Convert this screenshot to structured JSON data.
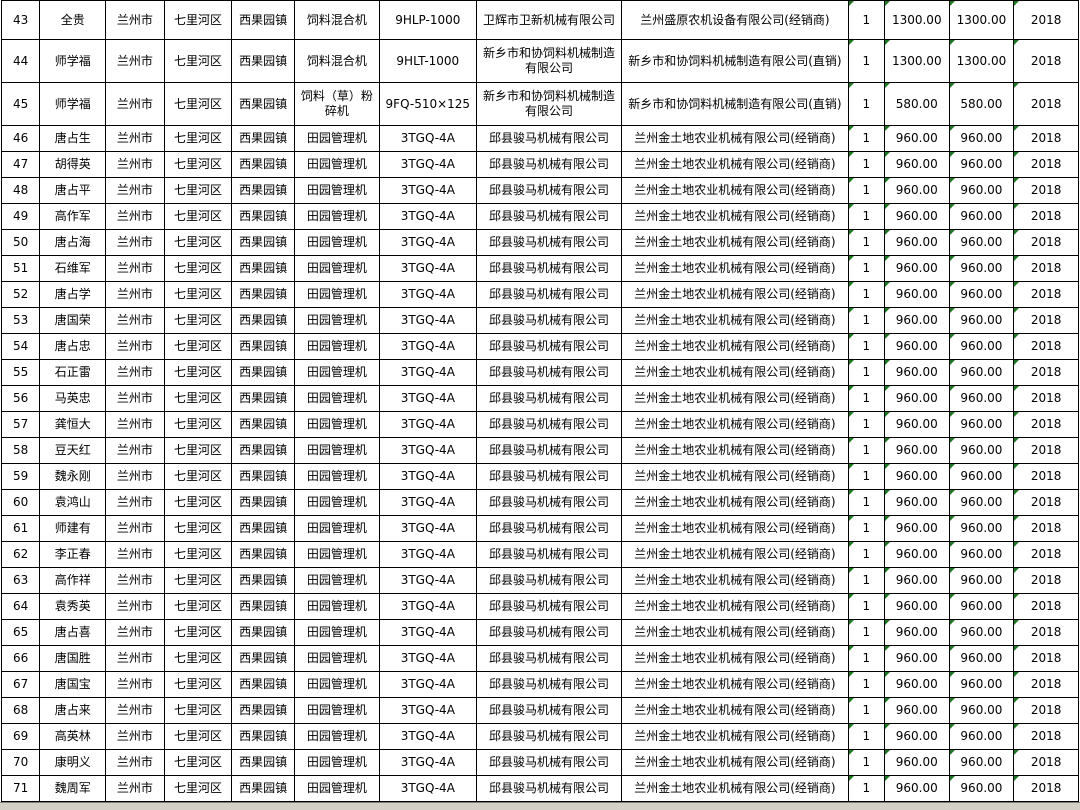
{
  "sheet": {
    "rows": [
      {
        "idx": "43",
        "name": "全贵",
        "city": "兰州市",
        "district": "七里河区",
        "town": "西果园镇",
        "machine": "饲料混合机",
        "model": "9HLP-1000",
        "maker": "卫辉市卫新机械有限公司",
        "dealer": "兰州盛原农机设备有限公司(经销商)",
        "qty": "1",
        "price": "1300.00",
        "total": "1300.00",
        "year": "2018",
        "height": "first"
      },
      {
        "idx": "44",
        "name": "师学福",
        "city": "兰州市",
        "district": "七里河区",
        "town": "西果园镇",
        "machine": "饲料混合机",
        "model": "9HLT-1000",
        "maker": "新乡市和协饲料机械制造有限公司",
        "dealer": "新乡市和协饲料机械制造有限公司(直销)",
        "qty": "1",
        "price": "1300.00",
        "total": "1300.00",
        "year": "2018",
        "height": "tall"
      },
      {
        "idx": "45",
        "name": "师学福",
        "city": "兰州市",
        "district": "七里河区",
        "town": "西果园镇",
        "machine": "饲料（草）粉碎机",
        "model": "9FQ-510×125",
        "maker": "新乡市和协饲料机械制造有限公司",
        "dealer": "新乡市和协饲料机械制造有限公司(直销)",
        "qty": "1",
        "price": "580.00",
        "total": "580.00",
        "year": "2018",
        "height": "tall"
      },
      {
        "idx": "46",
        "name": "唐占生",
        "city": "兰州市",
        "district": "七里河区",
        "town": "西果园镇",
        "machine": "田园管理机",
        "model": "3TGQ-4A",
        "maker": "邱县骏马机械有限公司",
        "dealer": "兰州金土地农业机械有限公司(经销商)",
        "qty": "1",
        "price": "960.00",
        "total": "960.00",
        "year": "2018",
        "height": "norm"
      },
      {
        "idx": "47",
        "name": "胡得英",
        "city": "兰州市",
        "district": "七里河区",
        "town": "西果园镇",
        "machine": "田园管理机",
        "model": "3TGQ-4A",
        "maker": "邱县骏马机械有限公司",
        "dealer": "兰州金土地农业机械有限公司(经销商)",
        "qty": "1",
        "price": "960.00",
        "total": "960.00",
        "year": "2018",
        "height": "norm"
      },
      {
        "idx": "48",
        "name": "唐占平",
        "city": "兰州市",
        "district": "七里河区",
        "town": "西果园镇",
        "machine": "田园管理机",
        "model": "3TGQ-4A",
        "maker": "邱县骏马机械有限公司",
        "dealer": "兰州金土地农业机械有限公司(经销商)",
        "qty": "1",
        "price": "960.00",
        "total": "960.00",
        "year": "2018",
        "height": "norm"
      },
      {
        "idx": "49",
        "name": "高作军",
        "city": "兰州市",
        "district": "七里河区",
        "town": "西果园镇",
        "machine": "田园管理机",
        "model": "3TGQ-4A",
        "maker": "邱县骏马机械有限公司",
        "dealer": "兰州金土地农业机械有限公司(经销商)",
        "qty": "1",
        "price": "960.00",
        "total": "960.00",
        "year": "2018",
        "height": "norm"
      },
      {
        "idx": "50",
        "name": "唐占海",
        "city": "兰州市",
        "district": "七里河区",
        "town": "西果园镇",
        "machine": "田园管理机",
        "model": "3TGQ-4A",
        "maker": "邱县骏马机械有限公司",
        "dealer": "兰州金土地农业机械有限公司(经销商)",
        "qty": "1",
        "price": "960.00",
        "total": "960.00",
        "year": "2018",
        "height": "norm"
      },
      {
        "idx": "51",
        "name": "石维军",
        "city": "兰州市",
        "district": "七里河区",
        "town": "西果园镇",
        "machine": "田园管理机",
        "model": "3TGQ-4A",
        "maker": "邱县骏马机械有限公司",
        "dealer": "兰州金土地农业机械有限公司(经销商)",
        "qty": "1",
        "price": "960.00",
        "total": "960.00",
        "year": "2018",
        "height": "norm"
      },
      {
        "idx": "52",
        "name": "唐占学",
        "city": "兰州市",
        "district": "七里河区",
        "town": "西果园镇",
        "machine": "田园管理机",
        "model": "3TGQ-4A",
        "maker": "邱县骏马机械有限公司",
        "dealer": "兰州金土地农业机械有限公司(经销商)",
        "qty": "1",
        "price": "960.00",
        "total": "960.00",
        "year": "2018",
        "height": "norm"
      },
      {
        "idx": "53",
        "name": "唐国荣",
        "city": "兰州市",
        "district": "七里河区",
        "town": "西果园镇",
        "machine": "田园管理机",
        "model": "3TGQ-4A",
        "maker": "邱县骏马机械有限公司",
        "dealer": "兰州金土地农业机械有限公司(经销商)",
        "qty": "1",
        "price": "960.00",
        "total": "960.00",
        "year": "2018",
        "height": "norm"
      },
      {
        "idx": "54",
        "name": "唐占忠",
        "city": "兰州市",
        "district": "七里河区",
        "town": "西果园镇",
        "machine": "田园管理机",
        "model": "3TGQ-4A",
        "maker": "邱县骏马机械有限公司",
        "dealer": "兰州金土地农业机械有限公司(经销商)",
        "qty": "1",
        "price": "960.00",
        "total": "960.00",
        "year": "2018",
        "height": "norm"
      },
      {
        "idx": "55",
        "name": "石正雷",
        "city": "兰州市",
        "district": "七里河区",
        "town": "西果园镇",
        "machine": "田园管理机",
        "model": "3TGQ-4A",
        "maker": "邱县骏马机械有限公司",
        "dealer": "兰州金土地农业机械有限公司(经销商)",
        "qty": "1",
        "price": "960.00",
        "total": "960.00",
        "year": "2018",
        "height": "norm"
      },
      {
        "idx": "56",
        "name": "马英忠",
        "city": "兰州市",
        "district": "七里河区",
        "town": "西果园镇",
        "machine": "田园管理机",
        "model": "3TGQ-4A",
        "maker": "邱县骏马机械有限公司",
        "dealer": "兰州金土地农业机械有限公司(经销商)",
        "qty": "1",
        "price": "960.00",
        "total": "960.00",
        "year": "2018",
        "height": "norm"
      },
      {
        "idx": "57",
        "name": "龚恒大",
        "city": "兰州市",
        "district": "七里河区",
        "town": "西果园镇",
        "machine": "田园管理机",
        "model": "3TGQ-4A",
        "maker": "邱县骏马机械有限公司",
        "dealer": "兰州金土地农业机械有限公司(经销商)",
        "qty": "1",
        "price": "960.00",
        "total": "960.00",
        "year": "2018",
        "height": "norm"
      },
      {
        "idx": "58",
        "name": "豆天红",
        "city": "兰州市",
        "district": "七里河区",
        "town": "西果园镇",
        "machine": "田园管理机",
        "model": "3TGQ-4A",
        "maker": "邱县骏马机械有限公司",
        "dealer": "兰州金土地农业机械有限公司(经销商)",
        "qty": "1",
        "price": "960.00",
        "total": "960.00",
        "year": "2018",
        "height": "norm"
      },
      {
        "idx": "59",
        "name": "魏永刚",
        "city": "兰州市",
        "district": "七里河区",
        "town": "西果园镇",
        "machine": "田园管理机",
        "model": "3TGQ-4A",
        "maker": "邱县骏马机械有限公司",
        "dealer": "兰州金土地农业机械有限公司(经销商)",
        "qty": "1",
        "price": "960.00",
        "total": "960.00",
        "year": "2018",
        "height": "norm"
      },
      {
        "idx": "60",
        "name": "袁鸿山",
        "city": "兰州市",
        "district": "七里河区",
        "town": "西果园镇",
        "machine": "田园管理机",
        "model": "3TGQ-4A",
        "maker": "邱县骏马机械有限公司",
        "dealer": "兰州金土地农业机械有限公司(经销商)",
        "qty": "1",
        "price": "960.00",
        "total": "960.00",
        "year": "2018",
        "height": "norm"
      },
      {
        "idx": "61",
        "name": "师建有",
        "city": "兰州市",
        "district": "七里河区",
        "town": "西果园镇",
        "machine": "田园管理机",
        "model": "3TGQ-4A",
        "maker": "邱县骏马机械有限公司",
        "dealer": "兰州金土地农业机械有限公司(经销商)",
        "qty": "1",
        "price": "960.00",
        "total": "960.00",
        "year": "2018",
        "height": "norm"
      },
      {
        "idx": "62",
        "name": "李正春",
        "city": "兰州市",
        "district": "七里河区",
        "town": "西果园镇",
        "machine": "田园管理机",
        "model": "3TGQ-4A",
        "maker": "邱县骏马机械有限公司",
        "dealer": "兰州金土地农业机械有限公司(经销商)",
        "qty": "1",
        "price": "960.00",
        "total": "960.00",
        "year": "2018",
        "height": "norm"
      },
      {
        "idx": "63",
        "name": "高作祥",
        "city": "兰州市",
        "district": "七里河区",
        "town": "西果园镇",
        "machine": "田园管理机",
        "model": "3TGQ-4A",
        "maker": "邱县骏马机械有限公司",
        "dealer": "兰州金土地农业机械有限公司(经销商)",
        "qty": "1",
        "price": "960.00",
        "total": "960.00",
        "year": "2018",
        "height": "norm"
      },
      {
        "idx": "64",
        "name": "袁秀英",
        "city": "兰州市",
        "district": "七里河区",
        "town": "西果园镇",
        "machine": "田园管理机",
        "model": "3TGQ-4A",
        "maker": "邱县骏马机械有限公司",
        "dealer": "兰州金土地农业机械有限公司(经销商)",
        "qty": "1",
        "price": "960.00",
        "total": "960.00",
        "year": "2018",
        "height": "norm"
      },
      {
        "idx": "65",
        "name": "唐占喜",
        "city": "兰州市",
        "district": "七里河区",
        "town": "西果园镇",
        "machine": "田园管理机",
        "model": "3TGQ-4A",
        "maker": "邱县骏马机械有限公司",
        "dealer": "兰州金土地农业机械有限公司(经销商)",
        "qty": "1",
        "price": "960.00",
        "total": "960.00",
        "year": "2018",
        "height": "norm"
      },
      {
        "idx": "66",
        "name": "唐国胜",
        "city": "兰州市",
        "district": "七里河区",
        "town": "西果园镇",
        "machine": "田园管理机",
        "model": "3TGQ-4A",
        "maker": "邱县骏马机械有限公司",
        "dealer": "兰州金土地农业机械有限公司(经销商)",
        "qty": "1",
        "price": "960.00",
        "total": "960.00",
        "year": "2018",
        "height": "norm"
      },
      {
        "idx": "67",
        "name": "唐国宝",
        "city": "兰州市",
        "district": "七里河区",
        "town": "西果园镇",
        "machine": "田园管理机",
        "model": "3TGQ-4A",
        "maker": "邱县骏马机械有限公司",
        "dealer": "兰州金土地农业机械有限公司(经销商)",
        "qty": "1",
        "price": "960.00",
        "total": "960.00",
        "year": "2018",
        "height": "norm"
      },
      {
        "idx": "68",
        "name": "唐占来",
        "city": "兰州市",
        "district": "七里河区",
        "town": "西果园镇",
        "machine": "田园管理机",
        "model": "3TGQ-4A",
        "maker": "邱县骏马机械有限公司",
        "dealer": "兰州金土地农业机械有限公司(经销商)",
        "qty": "1",
        "price": "960.00",
        "total": "960.00",
        "year": "2018",
        "height": "norm"
      },
      {
        "idx": "69",
        "name": "高英林",
        "city": "兰州市",
        "district": "七里河区",
        "town": "西果园镇",
        "machine": "田园管理机",
        "model": "3TGQ-4A",
        "maker": "邱县骏马机械有限公司",
        "dealer": "兰州金土地农业机械有限公司(经销商)",
        "qty": "1",
        "price": "960.00",
        "total": "960.00",
        "year": "2018",
        "height": "norm"
      },
      {
        "idx": "70",
        "name": "康明义",
        "city": "兰州市",
        "district": "七里河区",
        "town": "西果园镇",
        "machine": "田园管理机",
        "model": "3TGQ-4A",
        "maker": "邱县骏马机械有限公司",
        "dealer": "兰州金土地农业机械有限公司(经销商)",
        "qty": "1",
        "price": "960.00",
        "total": "960.00",
        "year": "2018",
        "height": "norm"
      },
      {
        "idx": "71",
        "name": "魏周军",
        "city": "兰州市",
        "district": "七里河区",
        "town": "西果园镇",
        "machine": "田园管理机",
        "model": "3TGQ-4A",
        "maker": "邱县骏马机械有限公司",
        "dealer": "兰州金土地农业机械有限公司(经销商)",
        "qty": "1",
        "price": "960.00",
        "total": "960.00",
        "year": "2018",
        "height": "norm"
      }
    ]
  },
  "colors": {
    "grid_line": "#000000",
    "background": "#ffffff",
    "comment_marker": "#1b7a1b",
    "status_bar": "#d4d0c8"
  }
}
